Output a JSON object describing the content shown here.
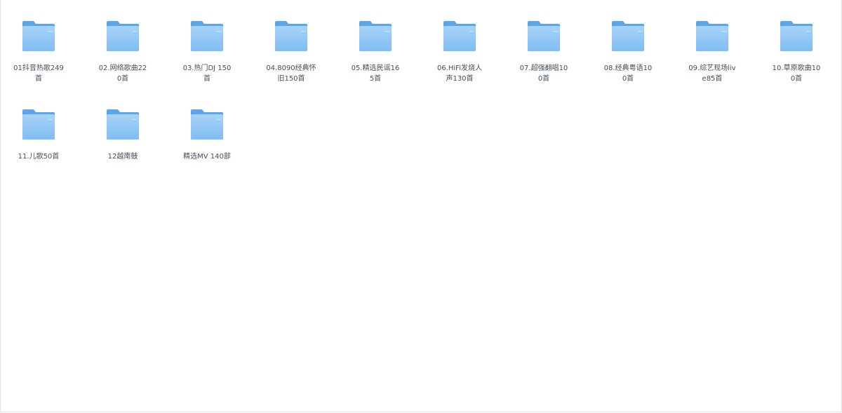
{
  "folders": [
    {
      "name": "01抖音热歌249首",
      "icon": "folder-icon"
    },
    {
      "name": "02.网络歌曲220首",
      "icon": "folder-icon"
    },
    {
      "name": "03.热门DJ 150首",
      "icon": "folder-icon"
    },
    {
      "name": "04.8090经典怀旧150首",
      "icon": "folder-icon"
    },
    {
      "name": "05.精选民谣165首",
      "icon": "folder-icon"
    },
    {
      "name": "06.HiFi发烧人声130首",
      "icon": "folder-icon"
    },
    {
      "name": "07.超强翻唱100首",
      "icon": "folder-icon"
    },
    {
      "name": "08.经典粤语100首",
      "icon": "folder-icon"
    },
    {
      "name": "09.综艺现场live85首",
      "icon": "folder-icon"
    },
    {
      "name": "10.草原歌曲100首",
      "icon": "folder-icon"
    },
    {
      "name": "11.儿歌50首",
      "icon": "folder-icon"
    },
    {
      "name": "12越南鼓",
      "icon": "folder-icon"
    },
    {
      "name": "精选MV 140部",
      "icon": "folder-icon"
    }
  ],
  "colors": {
    "folder_back": "#5aa6e8",
    "folder_front_top": "#a8d3f8",
    "folder_front_bottom": "#78b8f0",
    "label_text": "#454d5a"
  }
}
